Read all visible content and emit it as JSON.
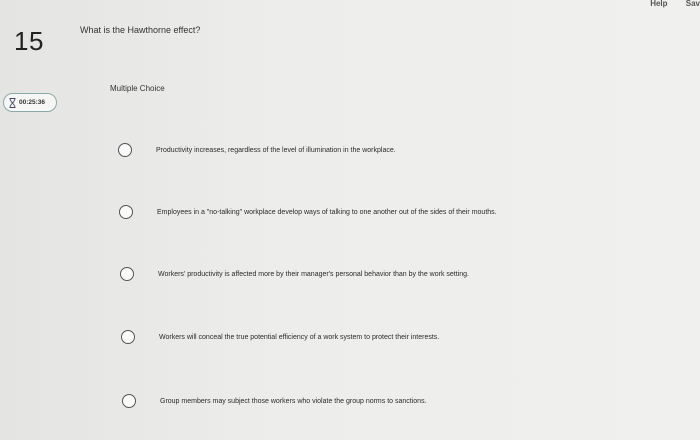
{
  "top_links": [
    "Help",
    "Sav"
  ],
  "question": {
    "number": "15",
    "text": "What is the Hawthorne effect?",
    "type": "Multiple Choice"
  },
  "timer": {
    "icon": "hourglass-icon",
    "value": "00:25:36"
  },
  "options": [
    "Productivity increases, regardless of the level of illumination in the workplace.",
    "Employees in a \"no-talking\" workplace develop ways of talking to one another out of the sides of their mouths.",
    "Workers' productivity is affected more by their manager's personal behavior than by the work setting.",
    "Workers will conceal the true potential efficiency of a work system to protect their interests.",
    "Group members may subject those workers who violate the group norms to sanctions."
  ]
}
